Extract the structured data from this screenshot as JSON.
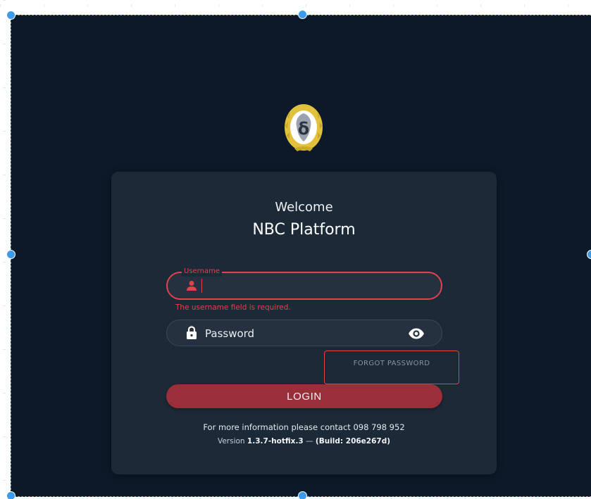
{
  "colors": {
    "background": "#0c1928",
    "card": "#1c2937",
    "error": "#e0434b",
    "login_button": "#9a2f3a",
    "logo_gold": "#e2c23c"
  },
  "brand": {
    "logo_icon": "emblem-logo-icon"
  },
  "header": {
    "welcome": "Welcome",
    "platform_name": "NBC Platform"
  },
  "form": {
    "username": {
      "label": "Username",
      "value": "",
      "icon": "user-icon",
      "error": "The username field is required."
    },
    "password": {
      "placeholder": "Password",
      "value": "",
      "icon": "lock-icon",
      "toggle_icon": "eye-icon"
    },
    "forgot_password_label": "FORGOT PASSWORD",
    "login_label": "LOGIN"
  },
  "footer": {
    "contact": "For more information please contact 098 798 952",
    "version_prefix": "Version",
    "version_number": "1.3.7-hotfix.3",
    "version_separator": "—",
    "build": "(Build: 206e267d)"
  }
}
